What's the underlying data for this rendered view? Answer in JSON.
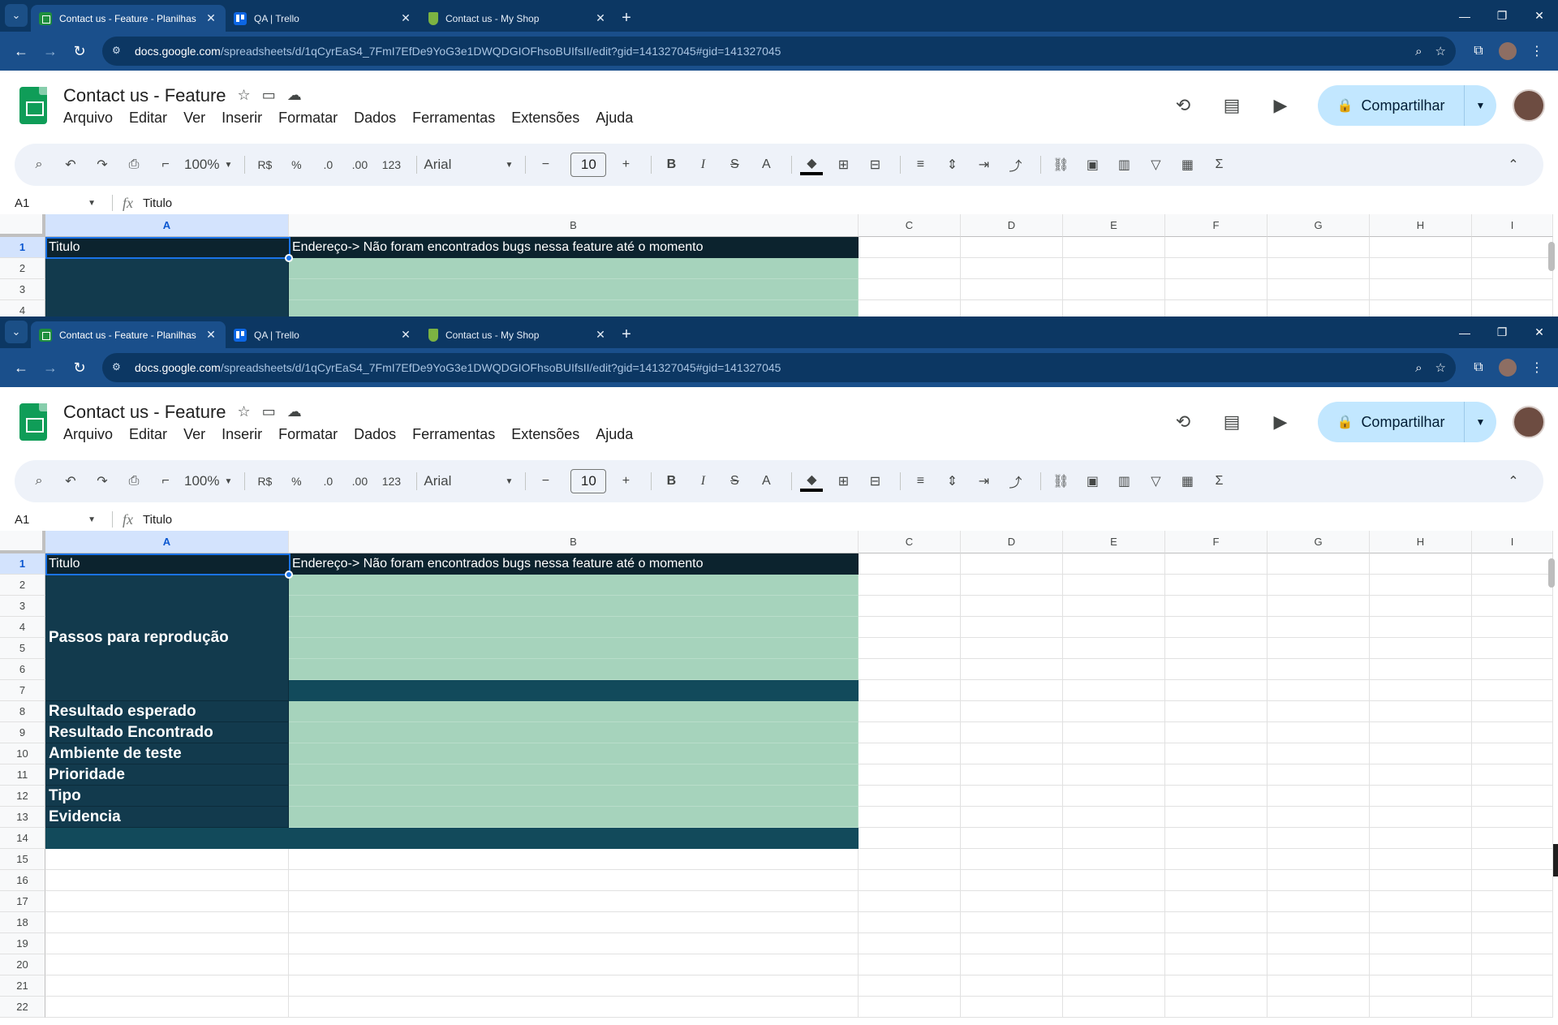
{
  "browser": {
    "tabs": [
      {
        "label": "Contact us - Feature - Planilhas",
        "icon": "sheets-icon",
        "active": true
      },
      {
        "label": "QA | Trello",
        "icon": "trello-icon",
        "active": false
      },
      {
        "label": "Contact us - My Shop",
        "icon": "shop-icon",
        "active": false
      }
    ],
    "url_host": "docs.google.com",
    "url_path": "/spreadsheets/d/1qCyrEaS4_7FmI7EfDe9YoG3e1DWQDGIOFhsoBUIfsII/edit?gid=141327045#gid=141327045"
  },
  "doc": {
    "title": "Contact us - Feature",
    "menu": [
      "Arquivo",
      "Editar",
      "Ver",
      "Inserir",
      "Formatar",
      "Dados",
      "Ferramentas",
      "Extensões",
      "Ajuda"
    ],
    "share_label": "Compartilhar"
  },
  "toolbar": {
    "zoom": "100%",
    "currency": "R$",
    "percent": "%",
    "dec_decrease": ".0",
    "dec_increase": ".00",
    "number_format": "123",
    "font": "Arial",
    "font_size": "10",
    "bold": "B",
    "italic": "I",
    "strike": "S",
    "text_color": "A",
    "sigma": "Σ"
  },
  "formula": {
    "cell_ref": "A1",
    "fx": "fx",
    "value": "Titulo"
  },
  "sheet": {
    "columns": [
      "A",
      "B",
      "C",
      "D",
      "E",
      "F",
      "G",
      "H",
      "I"
    ],
    "rows": [
      "1",
      "2",
      "3",
      "4",
      "5",
      "6",
      "7",
      "8",
      "9",
      "10",
      "11",
      "12",
      "13",
      "14",
      "15",
      "16",
      "17",
      "18",
      "19",
      "20",
      "21",
      "22"
    ],
    "a1": "Titulo",
    "b1": "Endereço-> Não foram encontrados bugs nessa feature até o momento",
    "steps_label": "Passos para reprodução",
    "labels": [
      "Resultado esperado",
      "Resultado Encontrado",
      "Ambiente de teste",
      "Prioridade",
      "Tipo",
      "Evidencia"
    ]
  },
  "colors": {
    "chrome_frame": "#0c3763",
    "chrome_toolbar": "#1a4f8b",
    "label_cell": "#123a4d",
    "title_cell": "#0c232e",
    "value_cell": "#a6d3bc",
    "share_button": "#c2e7ff"
  }
}
